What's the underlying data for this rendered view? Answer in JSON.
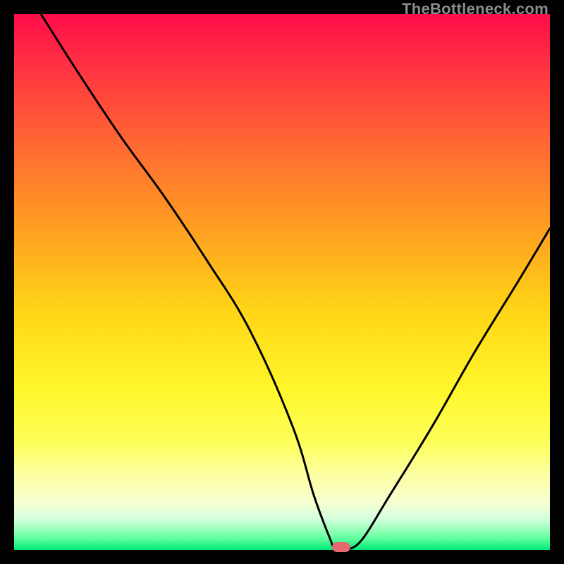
{
  "watermark": "TheBottleneck.com",
  "chart_data": {
    "type": "line",
    "title": "",
    "xlabel": "",
    "ylabel": "",
    "xlim": [
      0,
      100
    ],
    "ylim": [
      0,
      100
    ],
    "series": [
      {
        "name": "bottleneck-curve",
        "x": [
          5,
          12,
          20,
          28,
          36,
          44,
          52,
          56,
          59,
          60,
          62,
          65,
          70,
          78,
          86,
          94,
          100
        ],
        "y": [
          100,
          89,
          77,
          66,
          54,
          41,
          23,
          10,
          2,
          0,
          0,
          2,
          10,
          23,
          37,
          50,
          60
        ]
      }
    ],
    "annotations": [
      {
        "name": "min-marker",
        "type": "pill",
        "x": 61,
        "y": 0.5,
        "color": "#e46a70"
      }
    ],
    "gradient_bg": {
      "from": "#ff0d4a",
      "through": [
        "#ff9f21",
        "#fff72a",
        "#d6ffde"
      ],
      "to": "#00e97a"
    }
  }
}
